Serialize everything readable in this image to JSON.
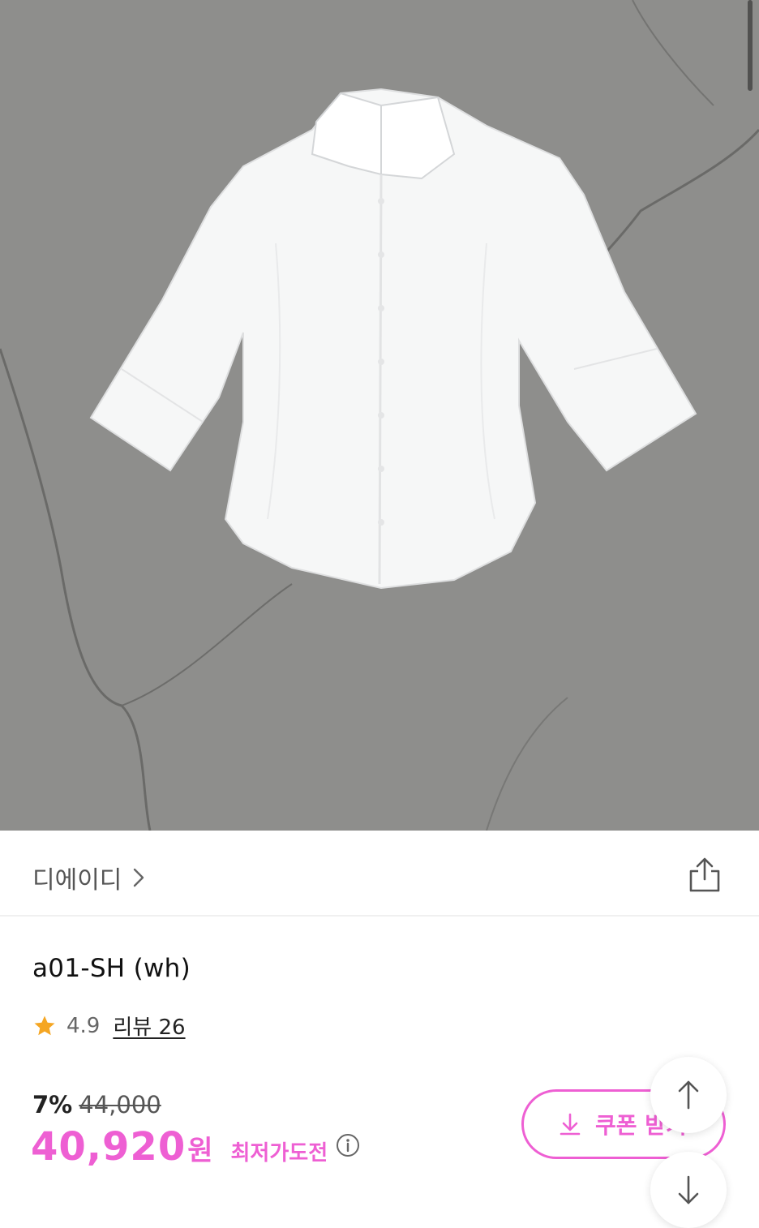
{
  "product_image": {
    "alt": "white shirt product photo"
  },
  "brand": {
    "name": "디에이디"
  },
  "product": {
    "title": "a01-SH (wh)"
  },
  "rating": {
    "score": "4.9",
    "review_label": "리뷰 26"
  },
  "pricing": {
    "discount_rate": "7%",
    "original_price": "44,000",
    "sale_price": "40,920",
    "currency": "원",
    "note": "최저가도전"
  },
  "coupon": {
    "label": "쿠폰 받기"
  },
  "colors": {
    "accent": "#ee5fd3",
    "star": "#f5a623"
  },
  "icons": {
    "brand_chevron": "chevron-right-icon",
    "share": "share-icon",
    "star": "star-icon",
    "info": "info-icon",
    "download": "download-icon",
    "scroll_up": "arrow-up-icon",
    "scroll_down": "arrow-down-icon"
  }
}
